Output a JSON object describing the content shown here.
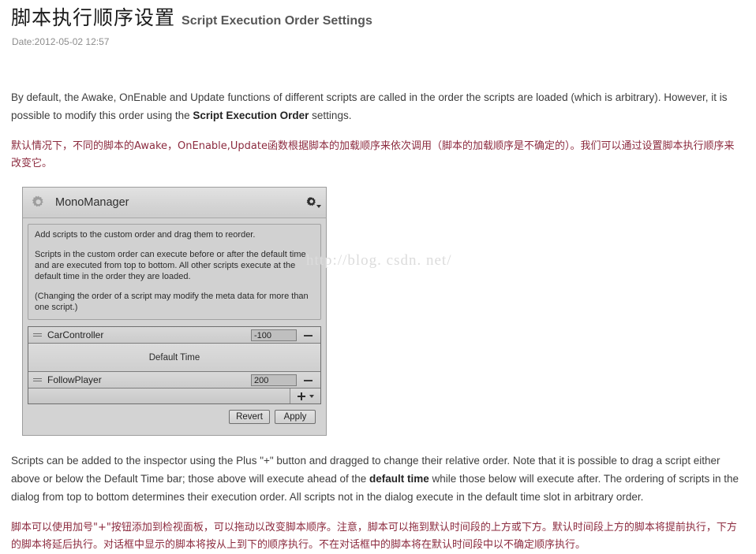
{
  "header": {
    "title_cn": "脚本执行顺序设置",
    "title_en": "Script Execution Order Settings",
    "date": "Date:2012-05-02 12:57"
  },
  "watermark": "http://blog. csdn. net/",
  "intro": {
    "en_part1": "By default, the Awake, OnEnable and Update functions of different scripts are called in the order the scripts are loaded (which is arbitrary). However, it is possible to modify this order using the ",
    "en_bold": "Script Execution Order",
    "en_part2": " settings.",
    "cn": "默认情况下，不同的脚本的Awake，OnEnable,Update函数根据脚本的加载顺序来依次调用（脚本的加载顺序是不确定的）。我们可以通过设置脚本执行顺序来改变它。"
  },
  "panel": {
    "title": "MonoManager",
    "gear_icon": "gear-icon",
    "settings_icon": "settings-gear-icon",
    "help": {
      "p1": "Add scripts to the custom order and drag them to reorder.",
      "p2": "Scripts in the custom order can execute before or after the default time and are executed from top to bottom. All other scripts execute at the default time in the order they are loaded.",
      "p3": "(Changing the order of a script may modify the meta data for more than one script.)"
    },
    "rows": [
      {
        "name": "CarController",
        "value": "-100",
        "handle_icon": "drag-handle-icon",
        "remove_icon": "minus-icon"
      },
      {
        "name": "FollowPlayer",
        "value": "200",
        "handle_icon": "drag-handle-icon",
        "remove_icon": "minus-icon"
      }
    ],
    "default_time_label": "Default Time",
    "add_button": {
      "icon": "plus-icon",
      "caret_icon": "chevron-down-icon"
    },
    "footer": {
      "revert_label": "Revert",
      "apply_label": "Apply"
    }
  },
  "outro": {
    "en_part1": "Scripts can be added to the inspector using the Plus \"+\" button and dragged to change their relative order. Note that it is possible to drag a script either above or below the Default Time bar; those above will execute ahead of the ",
    "en_bold": "default time",
    "en_part2": " while those below will execute after. The ordering of scripts in the dialog from top to bottom determines their execution order. All scripts not in the dialog execute in the default time slot in arbitrary order.",
    "cn": "脚本可以使用加号\"+\"按钮添加到检视面板，可以拖动以改变脚本顺序。注意，脚本可以拖到默认时间段的上方或下方。默认时间段上方的脚本将提前执行，下方的脚本将延后执行。对话框中显示的脚本将按从上到下的顺序执行。不在对话框中的脚本将在默认时间段中以不确定顺序执行。"
  },
  "colors": {
    "cn_text": "#8c2b3f",
    "en_text": "#3d3d3d",
    "panel_bg": "#d3d3d3"
  }
}
